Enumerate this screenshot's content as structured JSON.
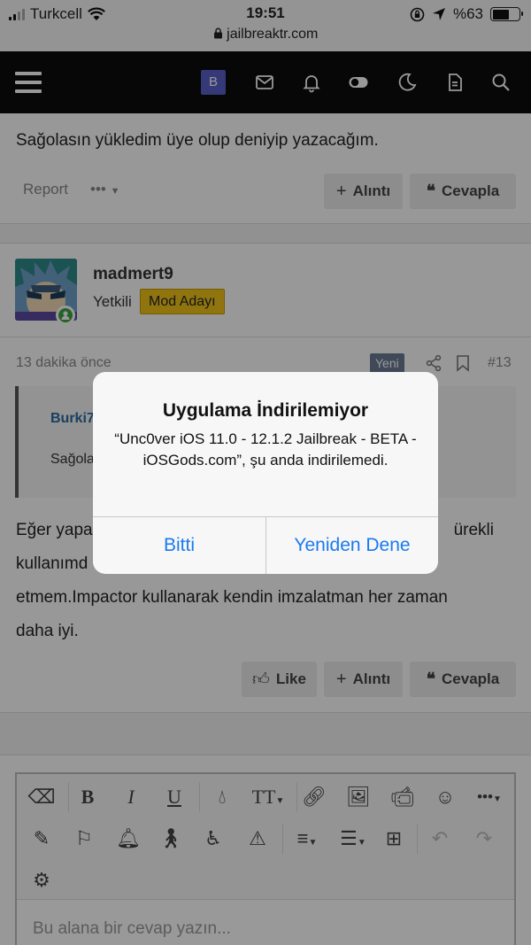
{
  "status_bar": {
    "carrier": "Turkcell",
    "time": "19:51",
    "battery": "%63",
    "battery_level": 0.63,
    "url": "jailbreaktr.com"
  },
  "nav": {
    "avatar_letter": "B",
    "icons": [
      "mail-icon",
      "bell-icon",
      "toggle-icon",
      "moon-icon",
      "document-icon",
      "search-icon"
    ]
  },
  "previous_post": {
    "text": "Sağolasın yükledim üye olup deniyip yazacağım.",
    "report_label": "Report",
    "more_label": "•••",
    "quote_button": "Alıntı",
    "reply_button": "Cevapla"
  },
  "post": {
    "username": "madmert9",
    "user_title": "Yetkili",
    "badge": "Mod Adayı",
    "time": "13 dakika önce",
    "new_badge": "Yeni",
    "number": "#13",
    "quote_author": "Burki7",
    "quote_text": "Sağola",
    "body_lines": [
      "Eğer yapa",
      "kullanımd",
      "etmem.Impactor kullanarak kendin imzalatman her zaman",
      "daha iyi."
    ],
    "body_line1_right": "ürekli",
    "like_button": "Like",
    "quote_button": "Alıntı",
    "reply_button": "Cevapla"
  },
  "editor": {
    "placeholder": "Bu alana bir cevap yazın..."
  },
  "dialog": {
    "title": "Uygulama İndirilemiyor",
    "message": "“Unc0ver iOS 11.0 - 12.1.2 Jailbreak - BETA - iOSGods.com”, şu anda indirilemedi.",
    "done_button": "Bitti",
    "retry_button": "Yeniden Dene"
  },
  "colors": {
    "accent": "#1a7af0",
    "badge_yellow": "#f0c419",
    "nav_bg": "#0d0d0d",
    "online": "#3fa33f"
  }
}
